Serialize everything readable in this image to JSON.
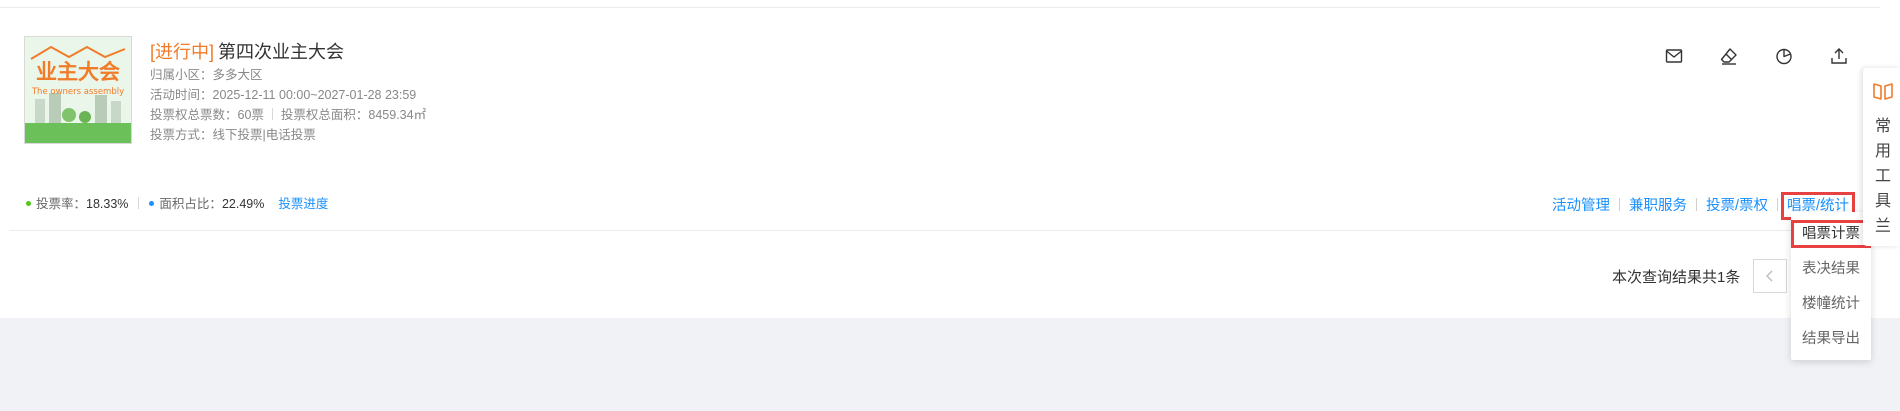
{
  "event": {
    "status": "[进行中]",
    "name": "第四次业主大会",
    "thumbnail_title": "业主大会",
    "thumbnail_subtitle": "The owners assembly",
    "community": "归属小区：多多大区",
    "period": "活动时间：2025-12-11 00:00~2027-01-28 23:59",
    "total_votes": "投票权总票数：60票",
    "total_area": "投票权总面积：8459.34㎡",
    "vote_method": "投票方式：线下投票|电话投票"
  },
  "stats": {
    "vote_rate_label": "投票率：",
    "vote_rate_value": "18.33%",
    "area_ratio_label": "面积占比：",
    "area_ratio_value": "22.49%",
    "progress_link": "投票进度",
    "vote_rate_color": "#52c41a",
    "area_ratio_color": "#1890ff"
  },
  "icons": [
    "mail-icon",
    "eraser-icon",
    "pie-chart-icon",
    "upload-icon"
  ],
  "actions": {
    "manage": "活动管理",
    "part_time": "兼职服务",
    "vote_right": "投票/票权",
    "count_stats": "唱票/统计"
  },
  "dropdown": {
    "items": [
      "唱票计票",
      "表决结果",
      "楼幢统计",
      "结果导出"
    ]
  },
  "pagination": {
    "info": "本次查询结果共1条"
  },
  "toolbar": {
    "label": "常用工具兰",
    "icon_color": "#f07c2a"
  },
  "colors": {
    "accent": "#1890ff",
    "status": "#f07c2a",
    "highlight": "#e84141"
  }
}
